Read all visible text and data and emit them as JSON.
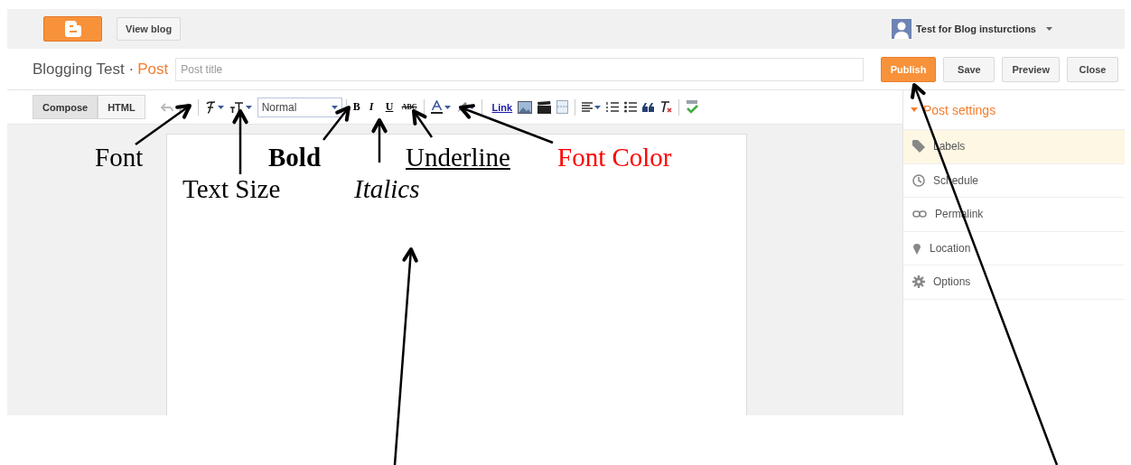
{
  "topbar": {
    "view_blog": "View blog",
    "user_name": "Test for Blog insturctions"
  },
  "title_row": {
    "blog_name": "Blogging Test",
    "separator": "·",
    "section": "Post",
    "title_placeholder": "Post title",
    "buttons": [
      {
        "label": "Publish",
        "kind": "primary"
      },
      {
        "label": "Save",
        "kind": "plain"
      },
      {
        "label": "Preview",
        "kind": "plain"
      },
      {
        "label": "Close",
        "kind": "plain"
      }
    ]
  },
  "mode_tabs": [
    {
      "label": "Compose",
      "selected": true
    },
    {
      "label": "HTML",
      "selected": false
    }
  ],
  "toolbar": [
    {
      "kind": "undo"
    },
    {
      "kind": "redo"
    },
    {
      "kind": "sep"
    },
    {
      "kind": "font"
    },
    {
      "kind": "size"
    },
    {
      "kind": "select",
      "text": "Normal"
    },
    {
      "kind": "sep"
    },
    {
      "kind": "bold",
      "text": "B"
    },
    {
      "kind": "italic",
      "text": "I"
    },
    {
      "kind": "underline",
      "text": "U"
    },
    {
      "kind": "strike",
      "text": "ABC"
    },
    {
      "kind": "sep"
    },
    {
      "kind": "color"
    },
    {
      "kind": "highlight"
    },
    {
      "kind": "sep"
    },
    {
      "kind": "link",
      "text": "Link"
    },
    {
      "kind": "image"
    },
    {
      "kind": "video"
    },
    {
      "kind": "jump"
    },
    {
      "kind": "sep"
    },
    {
      "kind": "align"
    },
    {
      "kind": "ol"
    },
    {
      "kind": "ul"
    },
    {
      "kind": "quote"
    },
    {
      "kind": "clear"
    },
    {
      "kind": "sep"
    },
    {
      "kind": "spell"
    }
  ],
  "sidebar": {
    "title": "Post settings",
    "expanded": true,
    "items": [
      {
        "label": "Labels",
        "kind": "tag",
        "selected": true
      },
      {
        "label": "Schedule",
        "kind": "clock",
        "selected": false
      },
      {
        "label": "Permalink",
        "kind": "link",
        "selected": false
      },
      {
        "label": "Location",
        "kind": "pin",
        "selected": false
      },
      {
        "label": "Options",
        "kind": "gear",
        "selected": false
      }
    ]
  },
  "annotations": [
    {
      "text": "Font",
      "kind": "plain",
      "color": "#000000"
    },
    {
      "text": "Text Size",
      "kind": "plain",
      "color": "#000000"
    },
    {
      "text": "Bold",
      "kind": "bold",
      "color": "#000000"
    },
    {
      "text": "Italics",
      "kind": "italic",
      "color": "#000000"
    },
    {
      "text": "Underline",
      "kind": "underline",
      "color": "#000000"
    },
    {
      "text": "Font Color",
      "kind": "plain",
      "color": "#ff0000"
    }
  ]
}
